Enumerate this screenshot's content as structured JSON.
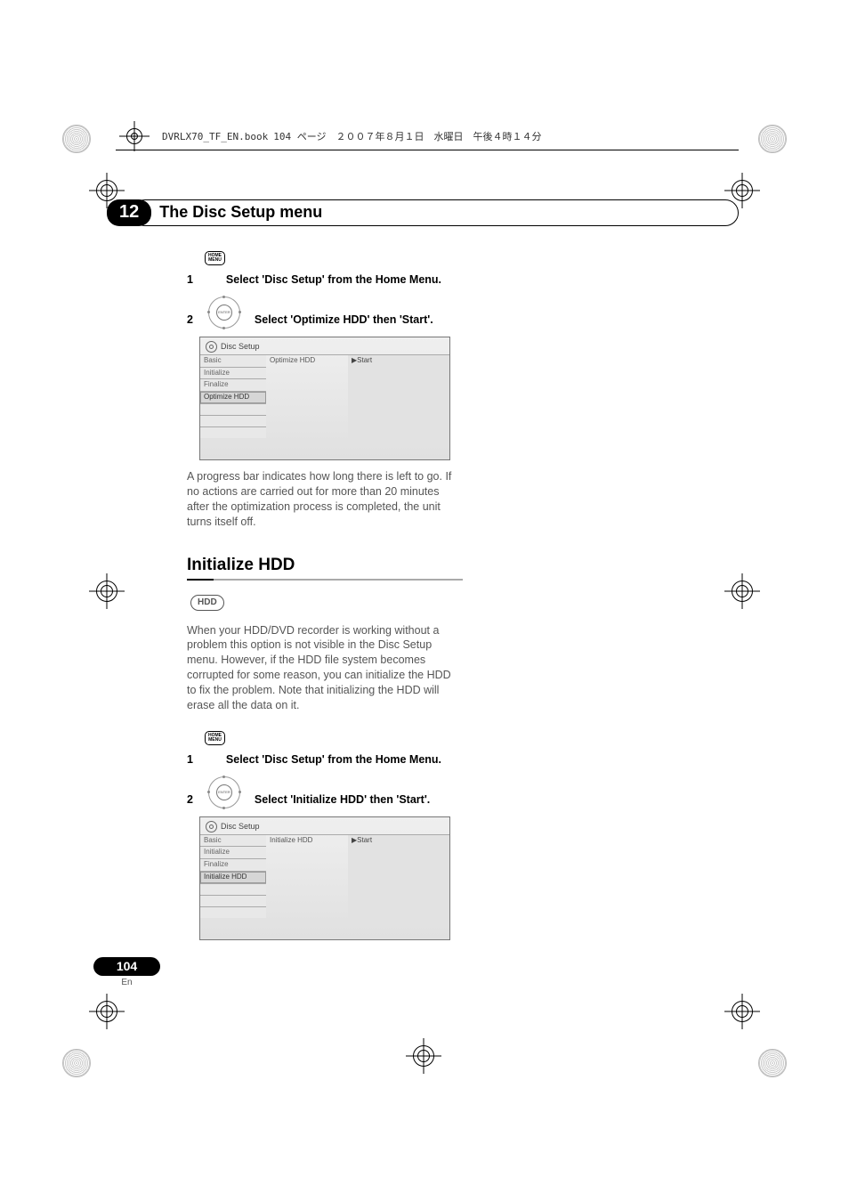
{
  "header": {
    "filename": "DVRLX70_TF_EN.book",
    "page_info": "104 ページ　２００７年８月１日　水曜日　午後４時１４分"
  },
  "chapter": {
    "number": "12",
    "title": "The Disc Setup menu"
  },
  "icon_labels": {
    "home_menu": "HOME\nMENU",
    "enter": "ENTER"
  },
  "section1": {
    "step1_num": "1",
    "step1_text": "Select 'Disc Setup' from the Home Menu.",
    "step2_num": "2",
    "step2_text": "Select 'Optimize HDD' then 'Start'.",
    "screenshot": {
      "title": "Disc Setup",
      "menu": [
        "Basic",
        "Initialize",
        "Finalize",
        "Optimize HDD"
      ],
      "highlighted": "Optimize HDD",
      "option": "Optimize HDD",
      "action": "▶Start"
    },
    "body": "A progress bar indicates how long there is left to go. If no actions are carried out for more than 20 minutes after the optimization process is completed, the unit turns itself off."
  },
  "section2": {
    "heading": "Initialize HDD",
    "badge": "HDD",
    "intro": "When your HDD/DVD recorder is working without a problem this option is not visible in the Disc Setup menu. However, if the HDD file system becomes corrupted for some reason, you can initialize the HDD to fix the problem. Note that initializing the HDD will erase all the data on it.",
    "step1_num": "1",
    "step1_text": "Select 'Disc Setup' from the Home Menu.",
    "step2_num": "2",
    "step2_text": "Select 'Initialize HDD' then 'Start'.",
    "screenshot": {
      "title": "Disc Setup",
      "menu": [
        "Basic",
        "Initialize",
        "Finalize",
        "Initialize HDD"
      ],
      "highlighted": "Initialize HDD",
      "option": "Initialize HDD",
      "action": "▶Start"
    }
  },
  "footer": {
    "page": "104",
    "lang": "En"
  }
}
